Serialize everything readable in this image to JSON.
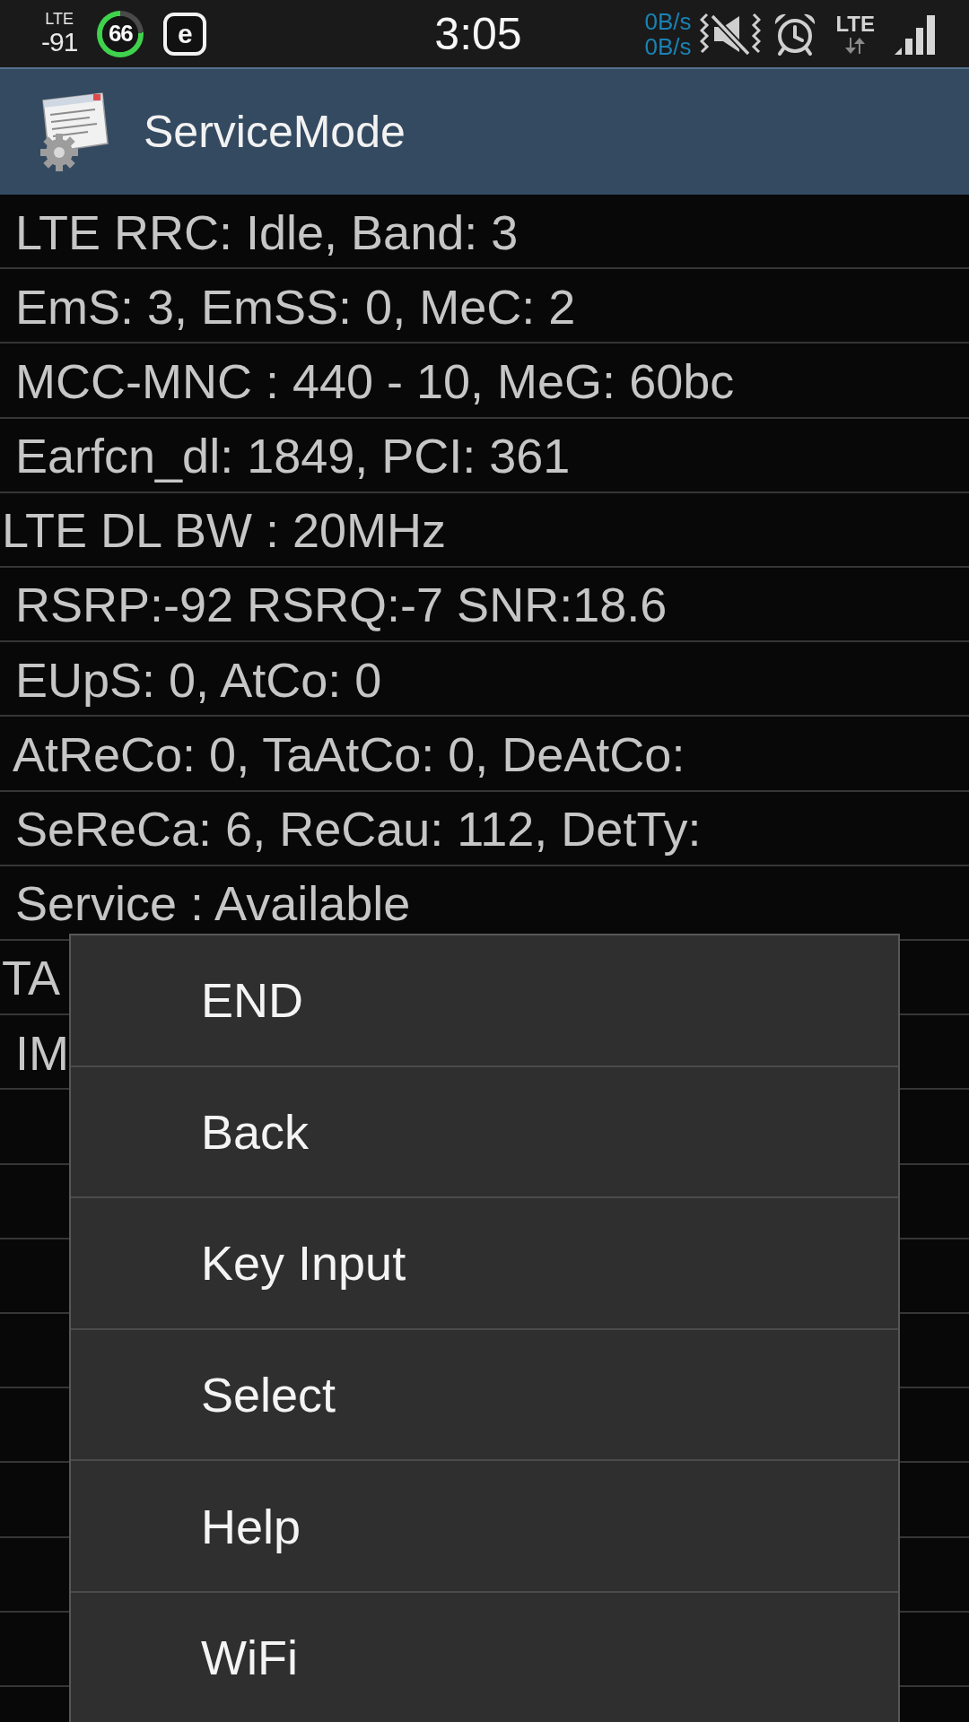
{
  "status_bar": {
    "network_label": "LTE",
    "signal_reading": "-91",
    "battery_percent": "66",
    "app_badge_glyph": "e",
    "time": "3:05",
    "data_rates": [
      "0B/s",
      "0B/s"
    ],
    "data_network_label": "LTE"
  },
  "app_bar": {
    "title": "ServiceMode"
  },
  "info_rows": [
    {
      "text": " LTE RRC: Idle, Band: 3"
    },
    {
      "text": " EmS: 3, EmSS: 0, MeC: 2"
    },
    {
      "text": " MCC-MNC : 440 - 10, MeG: 60bc"
    },
    {
      "text": " Earfcn_dl: 1849, PCI: 361"
    },
    {
      "text": "LTE DL BW : 20MHz"
    },
    {
      "text": " RSRP:-92 RSRQ:-7 SNR:18.6"
    },
    {
      "text": " EUpS: 0, AtCo: 0"
    },
    {
      "text": " AtReCo: 0, TaAtCo: 0, DeAtCo:"
    },
    {
      "text": " SeReCa: 6, ReCau: 112, DetTy:"
    },
    {
      "text": " Service : Available"
    },
    {
      "text": "TA"
    },
    {
      "text": " IM"
    }
  ],
  "popup_menu": {
    "items": [
      {
        "label": "END"
      },
      {
        "label": "Back"
      },
      {
        "label": "Key Input"
      },
      {
        "label": "Select"
      },
      {
        "label": "Help"
      },
      {
        "label": "WiFi"
      }
    ]
  }
}
